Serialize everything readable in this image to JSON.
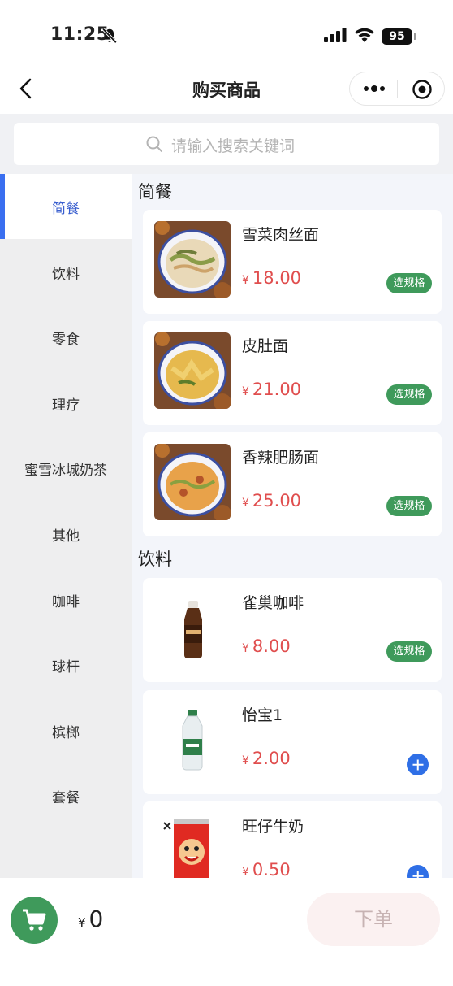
{
  "status": {
    "time": "11:25",
    "battery": "95"
  },
  "nav": {
    "title": "购买商品"
  },
  "search": {
    "placeholder": "请输入搜索关键词"
  },
  "sidebar": {
    "items": [
      {
        "label": "简餐",
        "active": true
      },
      {
        "label": "饮料"
      },
      {
        "label": "零食"
      },
      {
        "label": "理疗"
      },
      {
        "label": "蜜雪冰城奶茶"
      },
      {
        "label": "其他"
      },
      {
        "label": "咖啡"
      },
      {
        "label": "球杆"
      },
      {
        "label": "槟榔"
      },
      {
        "label": "套餐"
      }
    ]
  },
  "sections": [
    {
      "title": "简餐",
      "products": [
        {
          "name": "雪菜肉丝面",
          "price": "18.00",
          "action": "选规格",
          "icon": "noodle-bowl"
        },
        {
          "name": "皮肚面",
          "price": "21.00",
          "action": "选规格",
          "icon": "noodle-bowl"
        },
        {
          "name": "香辣肥肠面",
          "price": "25.00",
          "action": "选规格",
          "icon": "noodle-bowl"
        }
      ]
    },
    {
      "title": "饮料",
      "products": [
        {
          "name": "雀巢咖啡",
          "price": "8.00",
          "action": "选规格",
          "icon": "coffee-bottle"
        },
        {
          "name": "怡宝1",
          "price": "2.00",
          "action": "add",
          "icon": "water-bottle"
        },
        {
          "name": "旺仔牛奶",
          "price": "0.50",
          "action": "add",
          "icon": "milk-can"
        }
      ]
    }
  ],
  "currency": "¥",
  "cart": {
    "total": "0"
  },
  "order": {
    "label": "下单"
  },
  "colors": {
    "accent": "#3a6ff0",
    "green": "#3f9a5b",
    "price": "#e04e4e"
  }
}
